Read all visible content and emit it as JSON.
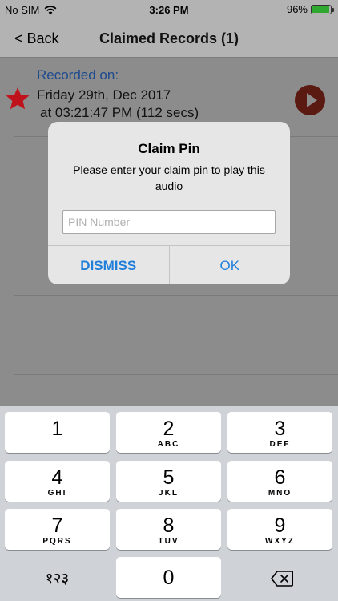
{
  "status": {
    "carrier": "No SIM",
    "time": "3:26 PM",
    "battery": "96%",
    "battery_level": 0.96,
    "battery_color": "#2fa82f"
  },
  "nav": {
    "back_label": "< Back",
    "title": "Claimed Records (1)"
  },
  "record": {
    "label": "Recorded on:",
    "date": "Friday 29th, Dec 2017",
    "time": "at 03:21:47 PM (112 secs)"
  },
  "dialog": {
    "title": "Claim Pin",
    "message": "Please enter your claim pin to play this audio",
    "input_placeholder": "PIN Number",
    "input_value": "",
    "dismiss_label": "DISMISS",
    "ok_label": "OK",
    "accent_color": "#1f7fdb"
  },
  "keypad": {
    "keys": [
      {
        "num": "1",
        "letters": ""
      },
      {
        "num": "2",
        "letters": "ABC"
      },
      {
        "num": "3",
        "letters": "DEF"
      },
      {
        "num": "4",
        "letters": "GHI"
      },
      {
        "num": "5",
        "letters": "JKL"
      },
      {
        "num": "6",
        "letters": "MNO"
      },
      {
        "num": "7",
        "letters": "PQRS"
      },
      {
        "num": "8",
        "letters": "TUV"
      },
      {
        "num": "9",
        "letters": "WXYZ"
      },
      {
        "num": "१२३",
        "letters": ""
      },
      {
        "num": "0",
        "letters": ""
      }
    ]
  },
  "icons": {
    "star": "star-icon",
    "play": "play-icon",
    "wifi": "wifi-icon",
    "delete": "delete-icon"
  }
}
